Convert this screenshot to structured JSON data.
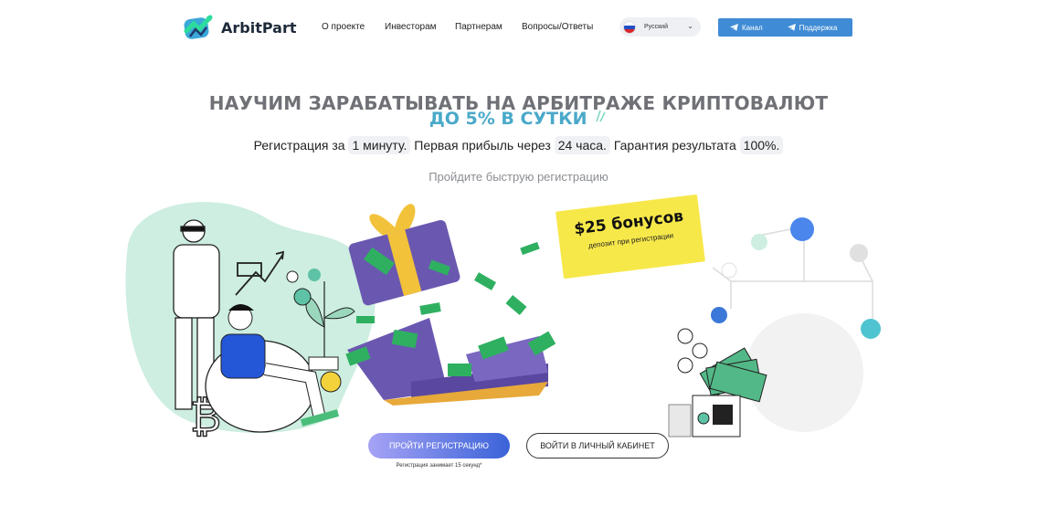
{
  "header": {
    "brand": "ArbitPart",
    "nav": [
      "О проекте",
      "Инвесторам",
      "Партнерам",
      "Вопросы/Ответы"
    ],
    "language": "Русский",
    "channel_label": "Канал",
    "support_label": "Поддержка"
  },
  "hero": {
    "title": "НАУЧИМ ЗАРАБАТЫВАТЬ НА АРБИТРАЖЕ КРИПТОВАЛЮТ",
    "subtitle": "ДО 5% В СУТКИ",
    "line_parts": [
      "Регистрация за",
      "1 минуту.",
      "Первая прибыль через",
      "24 часа.",
      "Гарантия результата",
      "100%."
    ],
    "hint": "Пройдите быструю регистрацию"
  },
  "bonus": {
    "title": "$25 бонусов",
    "subtitle": "депозит при регистрации"
  },
  "actions": {
    "register": "ПРОЙТИ РЕГИСТРАЦИЮ",
    "login": "ВОЙТИ В ЛИЧНЫЙ КАБИНЕТ",
    "register_note": "Регистрация занимает 15 секунд*"
  },
  "colors": {
    "accent_blue": "#3f8bd6",
    "subtitle_teal": "#4aa9c9",
    "bonus_yellow": "#f7e84a",
    "mint": "#ccefe1",
    "gift_purple": "#6a58b0"
  }
}
